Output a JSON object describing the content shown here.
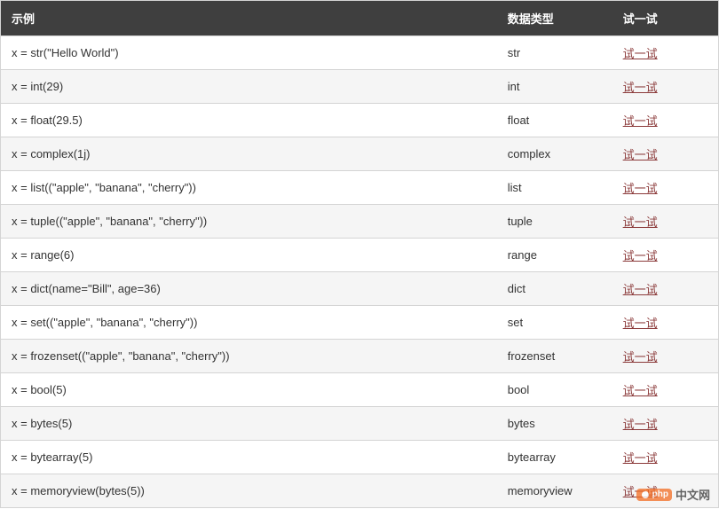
{
  "headers": {
    "example": "示例",
    "datatype": "数据类型",
    "try": "试一试"
  },
  "try_label": "试一试",
  "rows": [
    {
      "example": "x = str(\"Hello World\")",
      "datatype": "str"
    },
    {
      "example": "x = int(29)",
      "datatype": "int"
    },
    {
      "example": "x = float(29.5)",
      "datatype": "float"
    },
    {
      "example": "x = complex(1j)",
      "datatype": "complex"
    },
    {
      "example": "x = list((\"apple\", \"banana\", \"cherry\"))",
      "datatype": "list"
    },
    {
      "example": "x = tuple((\"apple\", \"banana\", \"cherry\"))",
      "datatype": "tuple"
    },
    {
      "example": "x = range(6)",
      "datatype": "range"
    },
    {
      "example": "x = dict(name=\"Bill\", age=36)",
      "datatype": "dict"
    },
    {
      "example": "x = set((\"apple\", \"banana\", \"cherry\"))",
      "datatype": "set"
    },
    {
      "example": "x = frozenset((\"apple\", \"banana\", \"cherry\"))",
      "datatype": "frozenset"
    },
    {
      "example": "x = bool(5)",
      "datatype": "bool"
    },
    {
      "example": "x = bytes(5)",
      "datatype": "bytes"
    },
    {
      "example": "x = bytearray(5)",
      "datatype": "bytearray"
    },
    {
      "example": "x = memoryview(bytes(5))",
      "datatype": "memoryview"
    }
  ],
  "watermark": {
    "badge": "php",
    "text": "中文网"
  }
}
